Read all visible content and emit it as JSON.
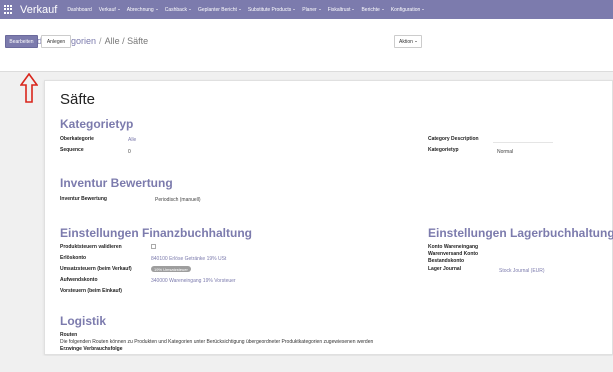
{
  "header": {
    "app_title": "Verkauf",
    "menu": [
      {
        "label": "Dashboard",
        "dropdown": false
      },
      {
        "label": "Verkauf",
        "dropdown": true
      },
      {
        "label": "Abrechnung",
        "dropdown": true
      },
      {
        "label": "Cashback",
        "dropdown": true
      },
      {
        "label": "Geplanter Bericht",
        "dropdown": true
      },
      {
        "label": "Substitute Products",
        "dropdown": true
      },
      {
        "label": "Planer",
        "dropdown": true
      },
      {
        "label": "Fiskaltrust",
        "dropdown": true
      },
      {
        "label": "Berichte",
        "dropdown": true
      },
      {
        "label": "Konfiguration",
        "dropdown": true
      }
    ]
  },
  "breadcrumb": {
    "root": "Produktkategorien",
    "separator": "/",
    "current": "Alle / Säfte"
  },
  "toolbar": {
    "edit_label": "Bearbeiten",
    "create_label": "Anlegen",
    "action_label": "Aktion"
  },
  "record": {
    "title": "Säfte",
    "sections": {
      "kategorietyp": "Kategorietyp",
      "inventur": "Inventur Bewertung",
      "finanz": "Einstellungen Finanzbuchhaltung",
      "lager": "Einstellungen Lagerbuchhaltung",
      "logistik": "Logistik"
    },
    "fields": {
      "oberkategorie": {
        "label": "Oberkategorie",
        "value": "Alle"
      },
      "sequence": {
        "label": "Sequence",
        "value": "0"
      },
      "category_description": {
        "label": "Category Description",
        "value": ""
      },
      "kategorietyp": {
        "label": "Kategorietyp",
        "value": "Normal"
      },
      "inventur_bewertung": {
        "label": "Inventur Bewertung",
        "value": "Periodisch (manuell)"
      },
      "produktsteuern": {
        "label": "Produktsteuern validieren",
        "checked": false
      },
      "erloeskonto": {
        "label": "Erlöskonto",
        "value": "840100 Erlöse Getränke 19% USt"
      },
      "umsatzsteuern": {
        "label": "Umsatzsteuern (beim Verkauf)",
        "tag": "19% Umsatzsteuer"
      },
      "aufwendskonto": {
        "label": "Aufwendskonto",
        "value": "340000 Wareneingang 19% Vorsteuer"
      },
      "vorsteuern": {
        "label": "Vorsteuern (beim Einkauf)",
        "value": ""
      },
      "konto_wareneingang": {
        "label": "Konto Wareneingang",
        "value": ""
      },
      "warenversand": {
        "label": "Warenversand Konto",
        "value": ""
      },
      "bestandskonto": {
        "label": "Bestandskonto",
        "value": ""
      },
      "lager_journal": {
        "label": "Lager Journal",
        "value": "Stock Journal (EUR)"
      },
      "routen": {
        "label": "Routen",
        "help": "Die folgenden Routen können zu Produkten und Kategorien unter Berücksichtigung übergeordneter Produktkategorien zugewiesenen werden"
      },
      "verbrauchsfolge": {
        "label": "Erzwinge Verbrauchsfolge",
        "value": ""
      }
    }
  },
  "colors": {
    "brand": "#7c7bad",
    "annotation_arrow": "#d9261c"
  },
  "icons": {
    "apps": "grid-icon",
    "annotation": "red-up-arrow-icon"
  }
}
